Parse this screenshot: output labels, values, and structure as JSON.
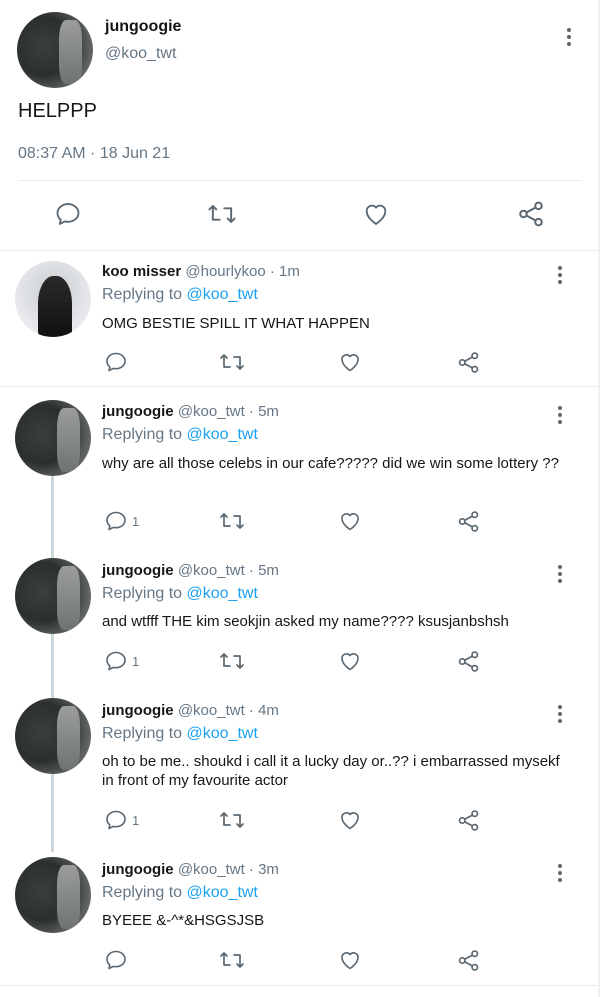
{
  "main_tweet": {
    "name": "jungoogie",
    "handle": "@koo_twt",
    "text": "HELPPP",
    "timestamp": "08:37 AM · 18 Jun 21",
    "icons": [
      "reply-icon",
      "retweet-icon",
      "like-icon",
      "share-icon"
    ]
  },
  "replies": [
    {
      "name": "koo misser",
      "meta": "@hourlykoo · 1m",
      "replying_prefix": "Replying to ",
      "replying_to": "@koo_twt",
      "text": "OMG BESTIE SPILL IT WHAT HAPPEN",
      "reply_count": ""
    },
    {
      "name": "jungoogie",
      "meta": "@koo_twt · 5m",
      "replying_prefix": "Replying to ",
      "replying_to": "@koo_twt",
      "text": "why are all those celebs in our cafe????? did we win some lottery ??",
      "reply_count": "1"
    },
    {
      "name": "jungoogie",
      "meta": "@koo_twt · 5m",
      "replying_prefix": "Replying to ",
      "replying_to": "@koo_twt",
      "text": "and wtfff THE kim seokjin asked my name????  ksusjanbshsh",
      "reply_count": "1"
    },
    {
      "name": "jungoogie",
      "meta": "@koo_twt · 4m",
      "replying_prefix": "Replying to ",
      "replying_to": "@koo_twt",
      "text": "oh to be me.. shoukd i call it a lucky day or..?? i embarrassed mysekf in front of my favourite actor",
      "reply_count": "1"
    },
    {
      "name": "jungoogie",
      "meta": "@koo_twt · 3m",
      "replying_prefix": "Replying to ",
      "replying_to": "@koo_twt",
      "text": "BYEEE &-^*&HSGSJSB",
      "reply_count": ""
    }
  ],
  "colors": {
    "link": "#1da1f2",
    "muted": "#657786",
    "text": "#14171a",
    "divider": "#e6ecf0",
    "icon": "#5b6770"
  }
}
